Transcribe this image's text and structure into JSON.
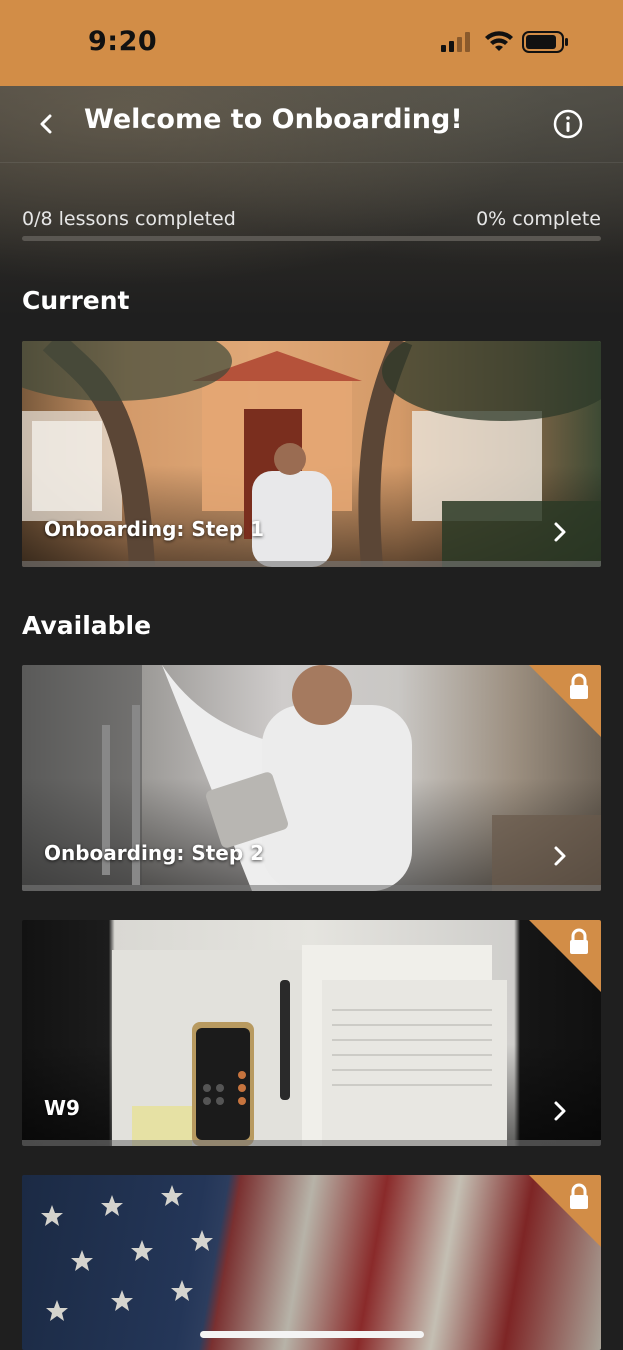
{
  "status_bar": {
    "time": "9:20"
  },
  "header": {
    "title": "Welcome to Onboarding!"
  },
  "progress": {
    "lessons_text": "0/8 lessons completed",
    "percent_text": "0% complete",
    "fraction": 0
  },
  "sections": {
    "current_title": "Current",
    "available_title": "Available"
  },
  "cards": {
    "current": [
      {
        "label": "Onboarding: Step 1",
        "locked": false
      }
    ],
    "available": [
      {
        "label": "Onboarding: Step 2",
        "locked": true
      },
      {
        "label": "W9",
        "locked": true
      },
      {
        "label": "",
        "locked": true
      }
    ]
  },
  "colors": {
    "accent": "#d28d47",
    "background": "#1f1f1f"
  },
  "icons": {
    "back": "chevron-left-icon",
    "info": "info-circle-icon",
    "lock": "lock-icon",
    "chevron": "chevron-right-icon"
  }
}
